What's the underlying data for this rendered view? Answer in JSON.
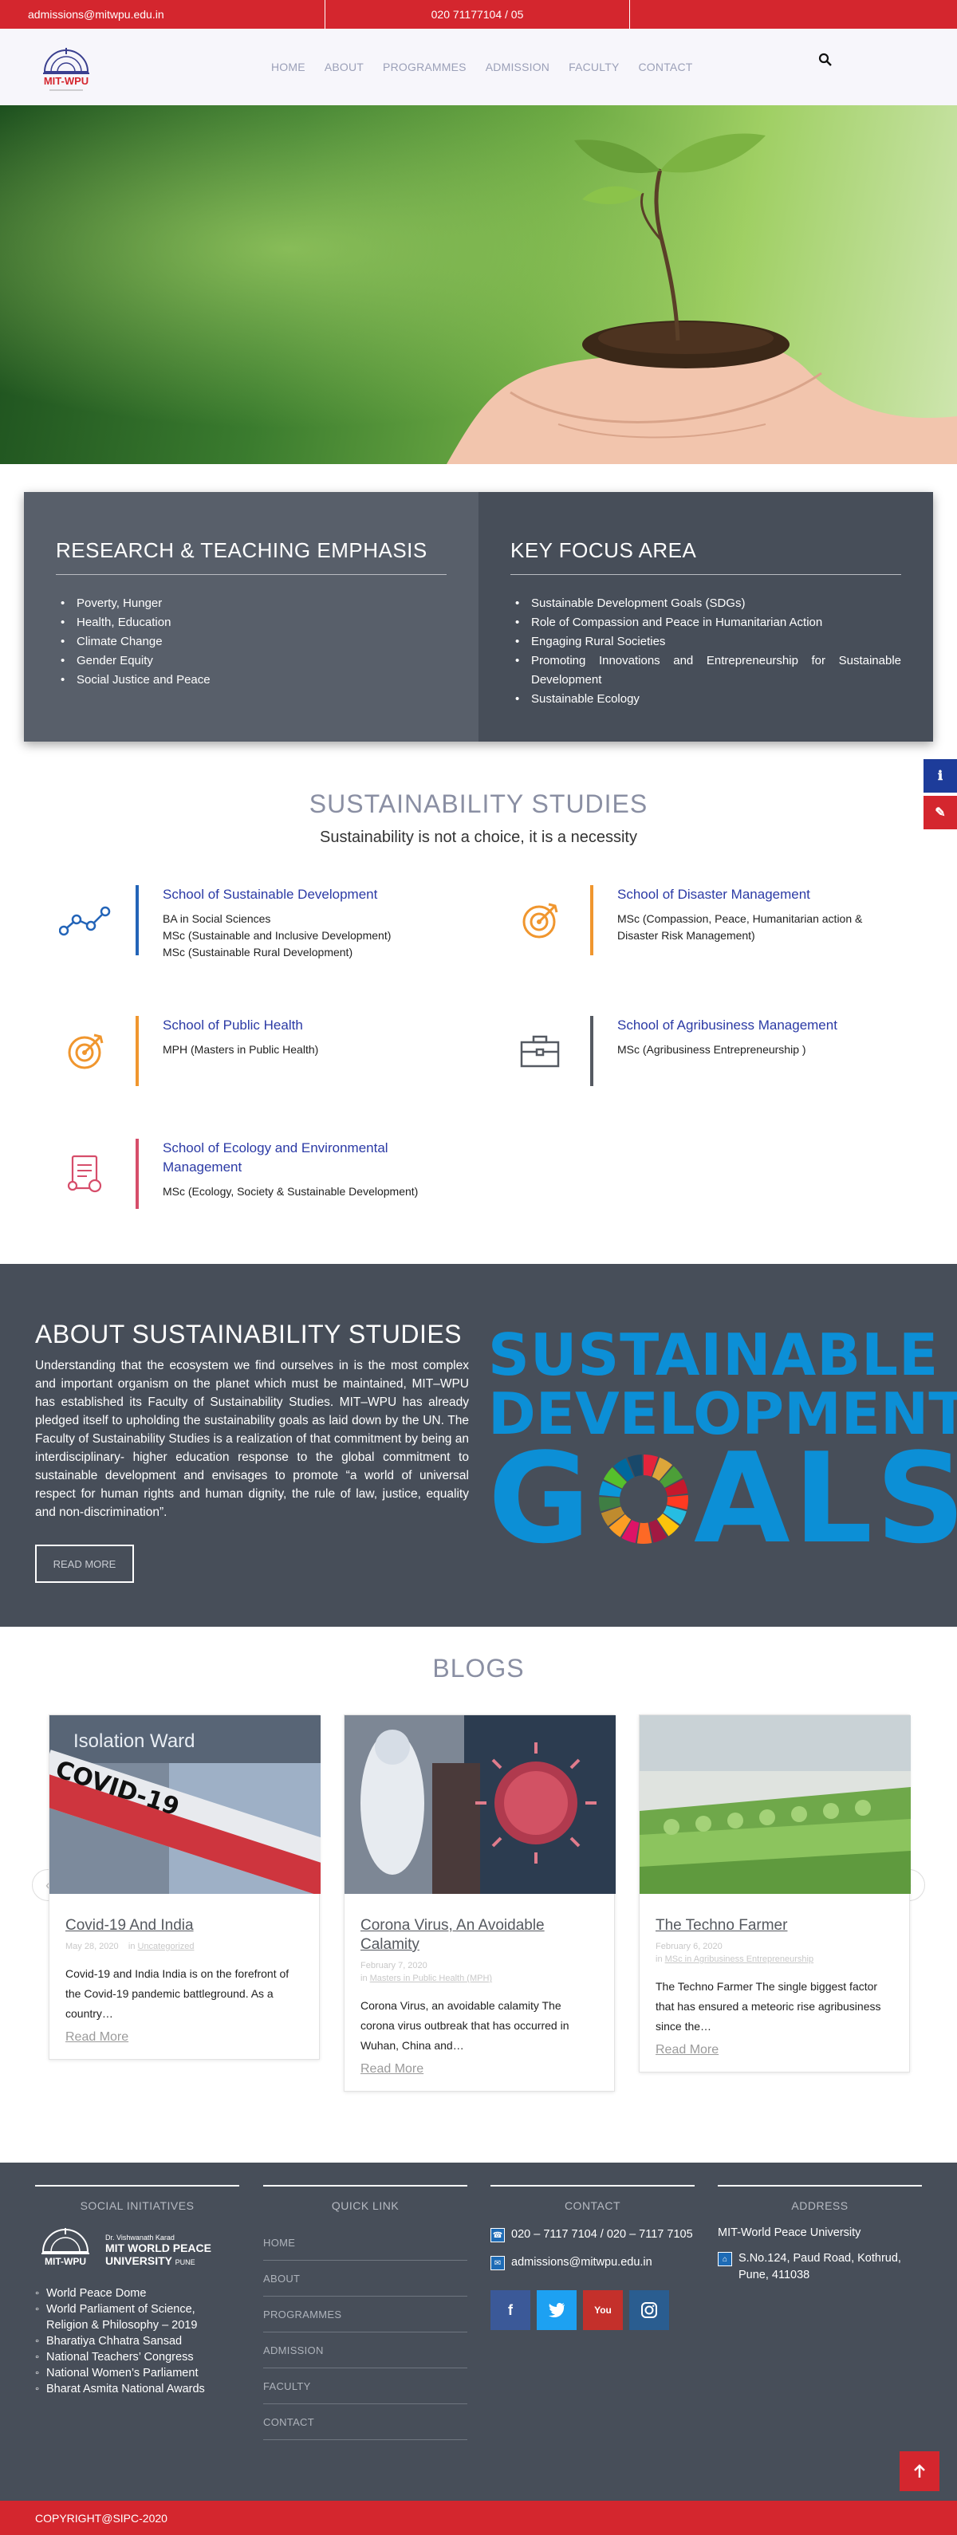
{
  "topbar": {
    "email": "admissions@mitwpu.edu.in",
    "phone": "020 71177104 / 05"
  },
  "header": {
    "logo_text": "MIT-WPU",
    "nav": [
      "HOME",
      "ABOUT",
      "PROGRAMMES",
      "ADMISSION",
      "FACULTY",
      "CONTACT"
    ]
  },
  "emphasis": {
    "left": {
      "title": "RESEARCH & TEACHING EMPHASIS",
      "items": [
        "Poverty, Hunger",
        "Health, Education",
        "Climate Change",
        "Gender Equity",
        "Social Justice and Peace"
      ]
    },
    "right": {
      "title": "KEY FOCUS AREA",
      "items": [
        "Sustainable Development Goals (SDGs)",
        "Role of Compassion and Peace in Humanitarian Action",
        "Engaging Rural Societies",
        "Promoting Innovations and Entrepreneurship for Sustainable Development",
        "Sustainable Ecology"
      ]
    }
  },
  "studies": {
    "title": "SUSTAINABILITY STUDIES",
    "subtitle": "Sustainability is not a choice, it is a necessity",
    "schools": [
      {
        "title": "School of Sustainable Development",
        "desc": "BA in Social Sciences\nMSc (Sustainable and Inclusive Development)\nMSc (Sustainable Rural Development)",
        "icon": "line-graph-icon",
        "color": "#2364b8"
      },
      {
        "title": "School of Disaster Management",
        "desc": "MSc (Compassion, Peace, Humanitarian action & Disaster Risk Management)",
        "icon": "target-icon",
        "color": "#f0962e"
      },
      {
        "title": "School of Public Health",
        "desc": "MPH (Masters in Public Health)",
        "icon": "target-icon",
        "color": "#f0962e"
      },
      {
        "title": "School of Agribusiness Management",
        "desc": "MSc (Agribusiness Entrepreneurship )",
        "icon": "briefcase-icon",
        "color": "#555a62"
      },
      {
        "title": "School of Ecology and Environmental Management",
        "desc": "MSc (Ecology, Society & Sustainable Development)",
        "icon": "document-icon",
        "color": "#d64d6a"
      }
    ]
  },
  "about": {
    "title": "ABOUT SUSTAINABILITY STUDIES",
    "body": "Understanding that the ecosystem we find ourselves in is the most complex and important organism on the planet which must be maintained, MIT–WPU has established its Faculty of Sustainability Studies. MIT–WPU has already pledged itself to upholding the sustainability goals as laid down by the UN. The Faculty of Sustainability Studies is a realization of that commitment by being an interdisciplinary- higher education response to the global commitment to sustainable development and envisages to promote “a world of universal respect for human rights and human dignity, the rule of law, justice, equality and non-discrimination”.",
    "button": "READ MORE",
    "sdg_line1": "SUSTAINABLE",
    "sdg_line2": "DEVELOPMENT",
    "sdg_line3_a": "G",
    "sdg_line3_b": "ALS"
  },
  "blogs": {
    "title": "BLOGS",
    "items": [
      {
        "title": "Covid-19 And India",
        "date": "May 28, 2020",
        "category": "Uncategorized",
        "excerpt": "Covid-19 and India India is on the forefront of the Covid-19 pandemic battleground. As a country…",
        "read_more": "Read More"
      },
      {
        "title": "Corona Virus, An Avoidable Calamity",
        "date": "February 7, 2020",
        "category": "Masters in Public Health (MPH)",
        "excerpt": "Corona Virus, an avoidable calamity The corona virus outbreak that has occurred in Wuhan, China and…",
        "read_more": "Read More"
      },
      {
        "title": "The Techno Farmer",
        "date": "February 6, 2020",
        "category": "MSc in Agribusiness Entrepreneurship",
        "excerpt": "The Techno Farmer The single biggest factor that has ensured a meteoric rise agribusiness since the…",
        "read_more": "Read More"
      }
    ],
    "image_text_1": "COVID-19",
    "image_text_2": "Isolation Ward"
  },
  "footer": {
    "social_title": "SOCIAL INITIATIVES",
    "social_logo_line1": "Dr. Vishwanath Karad",
    "social_logo_line2": "MIT WORLD PEACE",
    "social_logo_line3": "UNIVERSITY",
    "social_logo_line4": "PUNE",
    "social_items": [
      "World Peace Dome",
      "World Parliament of Science, Religion & Philosophy – 2019",
      "Bharatiya Chhatra Sansad",
      "National Teachers’ Congress",
      "National Women’s Parliament",
      "Bharat Asmita National Awards"
    ],
    "quick_title": "QUICK LINK",
    "quick_links": [
      "HOME",
      "ABOUT",
      "PROGRAMMES",
      "ADMISSION",
      "FACULTY",
      "CONTACT"
    ],
    "contact_title": "CONTACT",
    "contact_phone": "020 – 7117 7104 / 020 – 7117 7105",
    "contact_email": "admissions@mitwpu.edu.in",
    "address_title": "ADDRESS",
    "address_name": "MIT-World Peace University",
    "address_line": "S.No.124, Paud Road, Kothrud, Pune, 411038",
    "socials": [
      {
        "icon": "facebook-icon",
        "glyph": "f",
        "color": "#3b5998"
      },
      {
        "icon": "twitter-icon",
        "glyph": "t",
        "color": "#1da1f2"
      },
      {
        "icon": "youtube-icon",
        "glyph": "You",
        "color": "#c4302b"
      },
      {
        "icon": "instagram-icon",
        "glyph": "◎",
        "color": "#2a5d90"
      }
    ]
  },
  "copyright": "COPYRIGHT@SIPC-2020",
  "colors": {
    "brand_red": "#d4262e",
    "slate": "#474e59",
    "link_blue": "#2b3aa5"
  }
}
